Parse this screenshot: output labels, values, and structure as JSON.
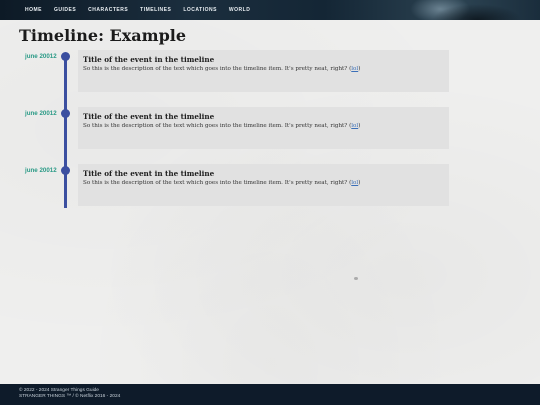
{
  "nav": {
    "items": [
      "HOME",
      "GUIDES",
      "CHARACTERS",
      "TIMELINES",
      "LOCATIONS",
      "WORLD"
    ]
  },
  "page": {
    "title": "Timeline: Example"
  },
  "timeline": {
    "events": [
      {
        "date": "june 20012",
        "title": "Title of the event in the timeline",
        "description": "So this is the description of the text which goes into the timeline item. It's pretty neat, right? (",
        "link": "lol",
        "close": ")"
      },
      {
        "date": "june 20012",
        "title": "Title of the event in the timeline",
        "description": "So this is the description of the text which goes into the timeline item. It's pretty neat, right? (",
        "link": "lol",
        "close": ")"
      },
      {
        "date": "june 20012",
        "title": "Title of the event in the timeline",
        "description": "So this is the description of the text which goes into the timeline item. It's pretty neat, right? (",
        "link": "lol",
        "close": ")"
      }
    ]
  },
  "footer": {
    "line1": "© 2022 - 2024 Stranger Things Guide",
    "line2": "STRANGER THINGS ™ / © Netflix 2016 - 2024"
  },
  "colors": {
    "accent": "#3b4fa0",
    "date": "#2a9a86",
    "link": "#3b6fb8",
    "footer_bg": "#0e1b2a"
  }
}
